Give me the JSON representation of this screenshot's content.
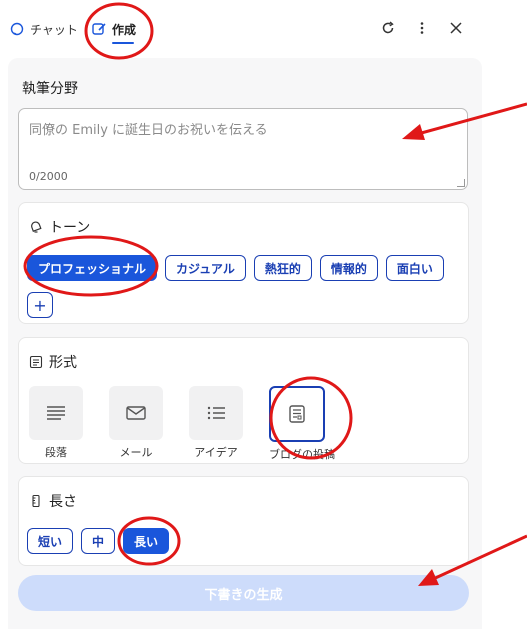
{
  "tabs": {
    "chat": "チャット",
    "compose": "作成"
  },
  "main": {
    "field_label": "執筆分野",
    "placeholder": "同僚の Emily に誕生日のお祝いを伝える",
    "counter": "0/2000"
  },
  "tone": {
    "title": "トーン",
    "options": [
      "プロフェッショナル",
      "カジュアル",
      "熱狂的",
      "情報的",
      "面白い"
    ],
    "selected": "プロフェッショナル",
    "add_label": "+"
  },
  "format": {
    "title": "形式",
    "options": [
      "段落",
      "メール",
      "アイデア",
      "ブログの投稿"
    ],
    "selected": "ブログの投稿"
  },
  "length": {
    "title": "長さ",
    "options": [
      "短い",
      "中",
      "長い"
    ],
    "selected": "長い"
  },
  "generate_label": "下書きの生成",
  "colors": {
    "accent": "#1a56db",
    "chip_border": "#1a3fb3",
    "button_disabled": "#cddcfb",
    "annotation": "#e01818"
  },
  "icons": {
    "chat": "chat-bubble-icon",
    "compose": "edit-icon",
    "refresh": "refresh-icon",
    "more": "more-vertical-icon",
    "close": "close-icon",
    "tone": "bell-icon",
    "format": "list-icon",
    "length": "ruler-icon"
  }
}
